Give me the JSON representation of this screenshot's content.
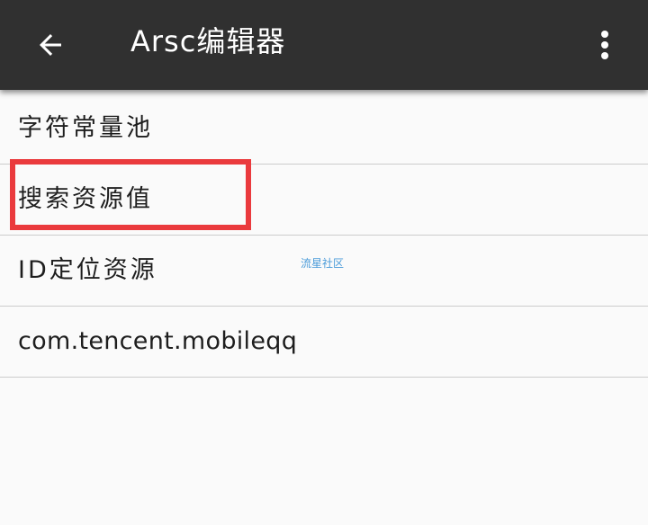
{
  "toolbar": {
    "title": "Arsc编辑器",
    "back_icon": "arrow-back-icon",
    "overflow_icon": "more-vert-icon",
    "background": "#303030"
  },
  "list": {
    "items": [
      {
        "label": "字符常量池"
      },
      {
        "label": "搜索资源值"
      },
      {
        "label": "ID定位资源"
      },
      {
        "label": "com.tencent.mobileqq"
      }
    ]
  },
  "highlight": {
    "target": "搜索资源值",
    "color": "#ea3a3d"
  },
  "watermark": {
    "text": "流星社区",
    "color": "#4a9bd9"
  }
}
